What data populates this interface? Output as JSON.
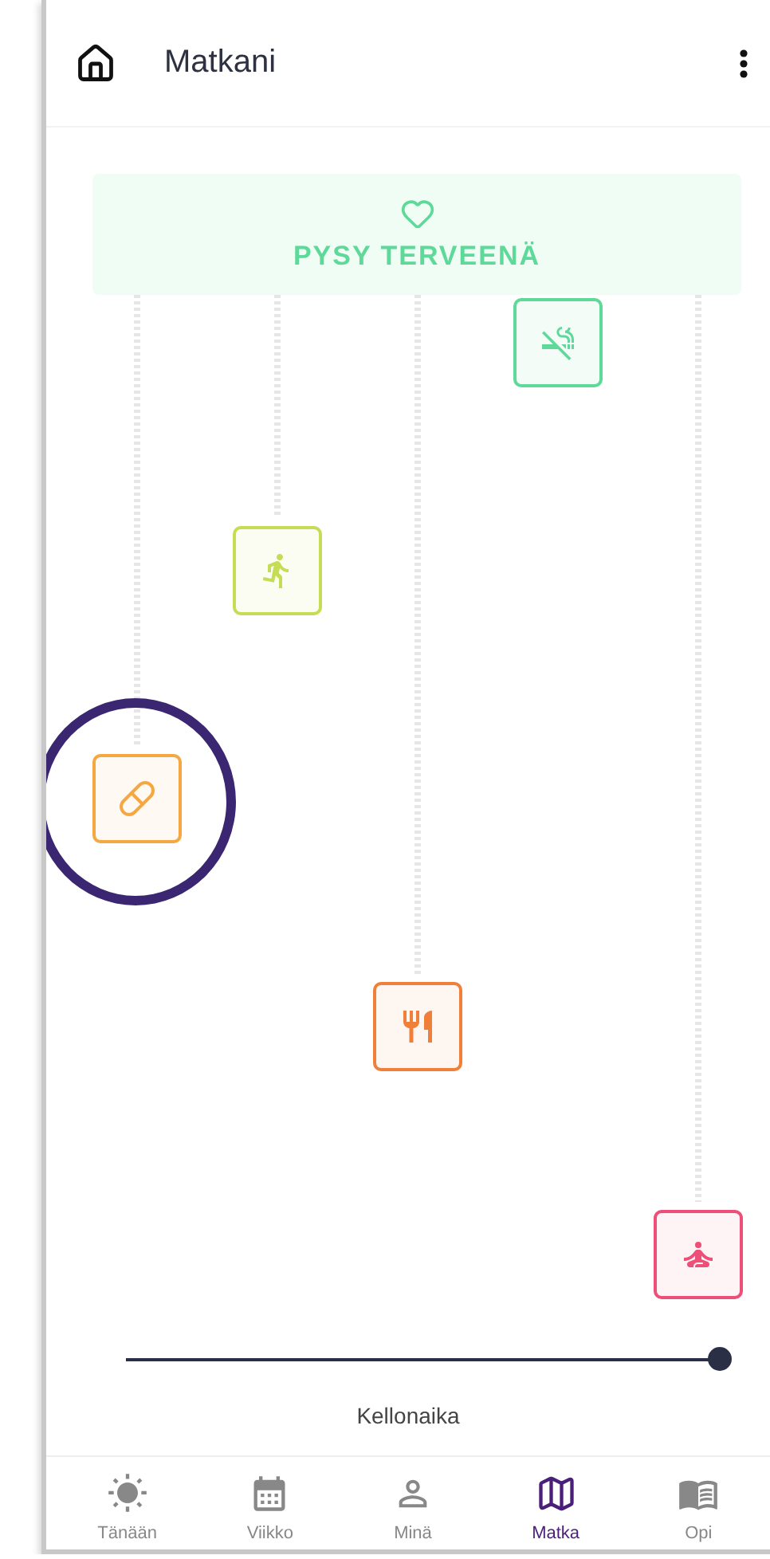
{
  "header": {
    "title": "Matkani"
  },
  "goal": {
    "title": "PYSY TERVEENÄ"
  },
  "steps": [
    {
      "kind": "smoking",
      "color": "#5fd99a",
      "highlighted": false
    },
    {
      "kind": "running",
      "color": "#c5dc55",
      "highlighted": false
    },
    {
      "kind": "pill",
      "color": "#f5a742",
      "highlighted": true
    },
    {
      "kind": "food",
      "color": "#f07f3a",
      "highlighted": false
    },
    {
      "kind": "meditation",
      "color": "#ee4f78",
      "highlighted": false
    }
  ],
  "slider": {
    "level": 1,
    "label": "Kellonaika"
  },
  "nav": [
    {
      "label": "Tänään",
      "selected": false
    },
    {
      "label": "Viikko",
      "selected": false
    },
    {
      "label": "Minä",
      "selected": false
    },
    {
      "label": "Matka",
      "selected": true
    },
    {
      "label": "Opi",
      "selected": false
    }
  ]
}
